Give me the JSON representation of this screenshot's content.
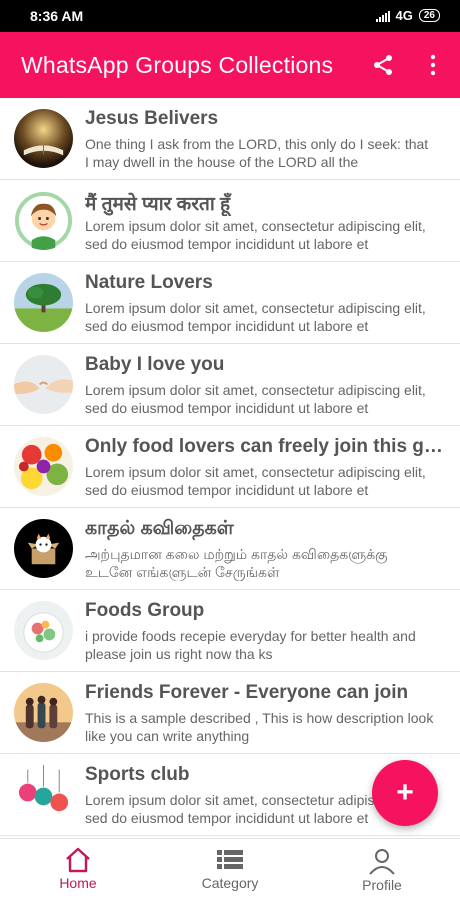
{
  "status_bar": {
    "time": "8:36 AM",
    "network": "4G",
    "battery": "26"
  },
  "app_bar": {
    "title": "WhatsApp Groups Collections",
    "share_icon": "share-icon",
    "more_icon": "more-vert-icon",
    "color": "#f5125f"
  },
  "groups": [
    {
      "title": "Jesus Belivers",
      "description": "One thing I ask from the LORD, this only do I seek: that I may dwell in the house of the LORD all the"
    },
    {
      "title": "मैं तुमसे प्यार करता हूँ",
      "description": "Lorem ipsum dolor sit amet, consectetur adipiscing elit, sed do eiusmod tempor incididunt ut labore et"
    },
    {
      "title": "Nature Lovers",
      "description": "Lorem ipsum dolor sit amet, consectetur adipiscing elit, sed do eiusmod tempor incididunt ut labore et"
    },
    {
      "title": "Baby I love you",
      "description": "Lorem ipsum dolor sit amet, consectetur adipiscing elit, sed do eiusmod tempor incididunt ut labore et"
    },
    {
      "title": "Only food lovers can freely join this group",
      "description": "Lorem ipsum dolor sit amet, consectetur adipiscing elit, sed do eiusmod tempor incididunt ut labore et"
    },
    {
      "title": "காதல் கவிதைகள்",
      "description": "அற்புதமான கலை மற்றும் காதல் கவிதைகளுக்கு உடனே எங்களுடன் சேருங்கள்"
    },
    {
      "title": "Foods Group",
      "description": "i provide foods recepie everyday for better health and please join us right now tha ks"
    },
    {
      "title": "Friends Forever - Everyone can join",
      "description": "This is a sample described , This is how description look like you can write anything"
    },
    {
      "title": "Sports club",
      "description": "Lorem ipsum dolor sit amet, consectetur adipiscing elit, sed do eiusmod tempor incididunt ut labore et"
    }
  ],
  "fab": {
    "label": "+",
    "icon": "add-icon"
  },
  "bottom_nav": {
    "items": [
      {
        "label": "Home",
        "icon": "home-icon",
        "active": true
      },
      {
        "label": "Category",
        "icon": "list-icon",
        "active": false
      },
      {
        "label": "Profile",
        "icon": "person-icon",
        "active": false
      }
    ],
    "active_color": "#c2185b"
  }
}
